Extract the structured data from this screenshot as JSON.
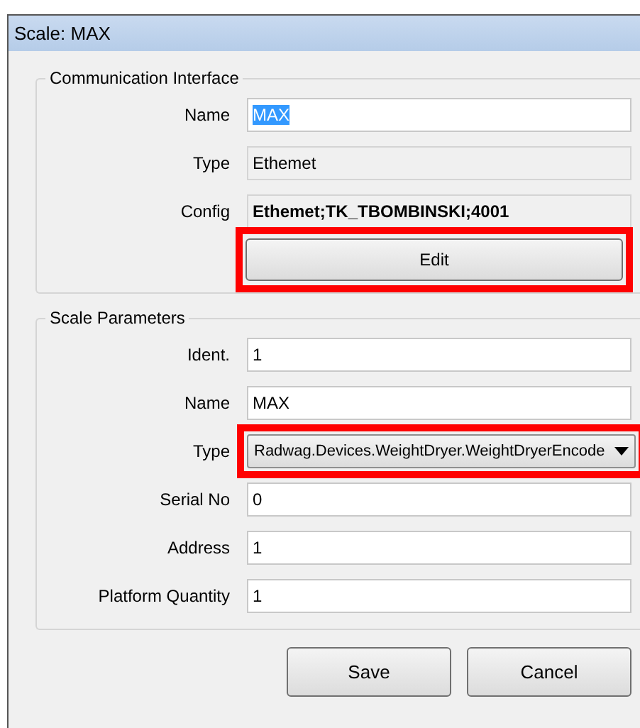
{
  "window": {
    "title": "Scale: MAX"
  },
  "communication_interface": {
    "title": "Communication Interface",
    "fields": [
      {
        "kind": "input",
        "label": "Name",
        "value": "MAX",
        "text_selected": true
      },
      {
        "kind": "readonly",
        "label": "Type",
        "value": "Ethemet"
      },
      {
        "kind": "readonly_bold",
        "label": "Config",
        "value": "Ethemet;TK_TBOMBINSKI;4001"
      }
    ],
    "edit_button": {
      "label": "Edit",
      "highlighted": true
    }
  },
  "scale_parameters": {
    "title": "Scale Parameters",
    "fields": [
      {
        "kind": "input",
        "label": "Ident.",
        "value": "1"
      },
      {
        "kind": "input",
        "label": "Name",
        "value": "MAX"
      },
      {
        "kind": "dropdown",
        "label": "Type",
        "value": "Radwag.Devices.WeightDryer.WeightDryerEncode",
        "highlighted": true
      },
      {
        "kind": "input",
        "label": "Serial No",
        "value": "0"
      },
      {
        "kind": "input",
        "label": "Address",
        "value": "1"
      },
      {
        "kind": "input",
        "label": "Platform Quantity",
        "value": "1"
      }
    ]
  },
  "buttons": [
    "Save",
    "Cancel"
  ]
}
